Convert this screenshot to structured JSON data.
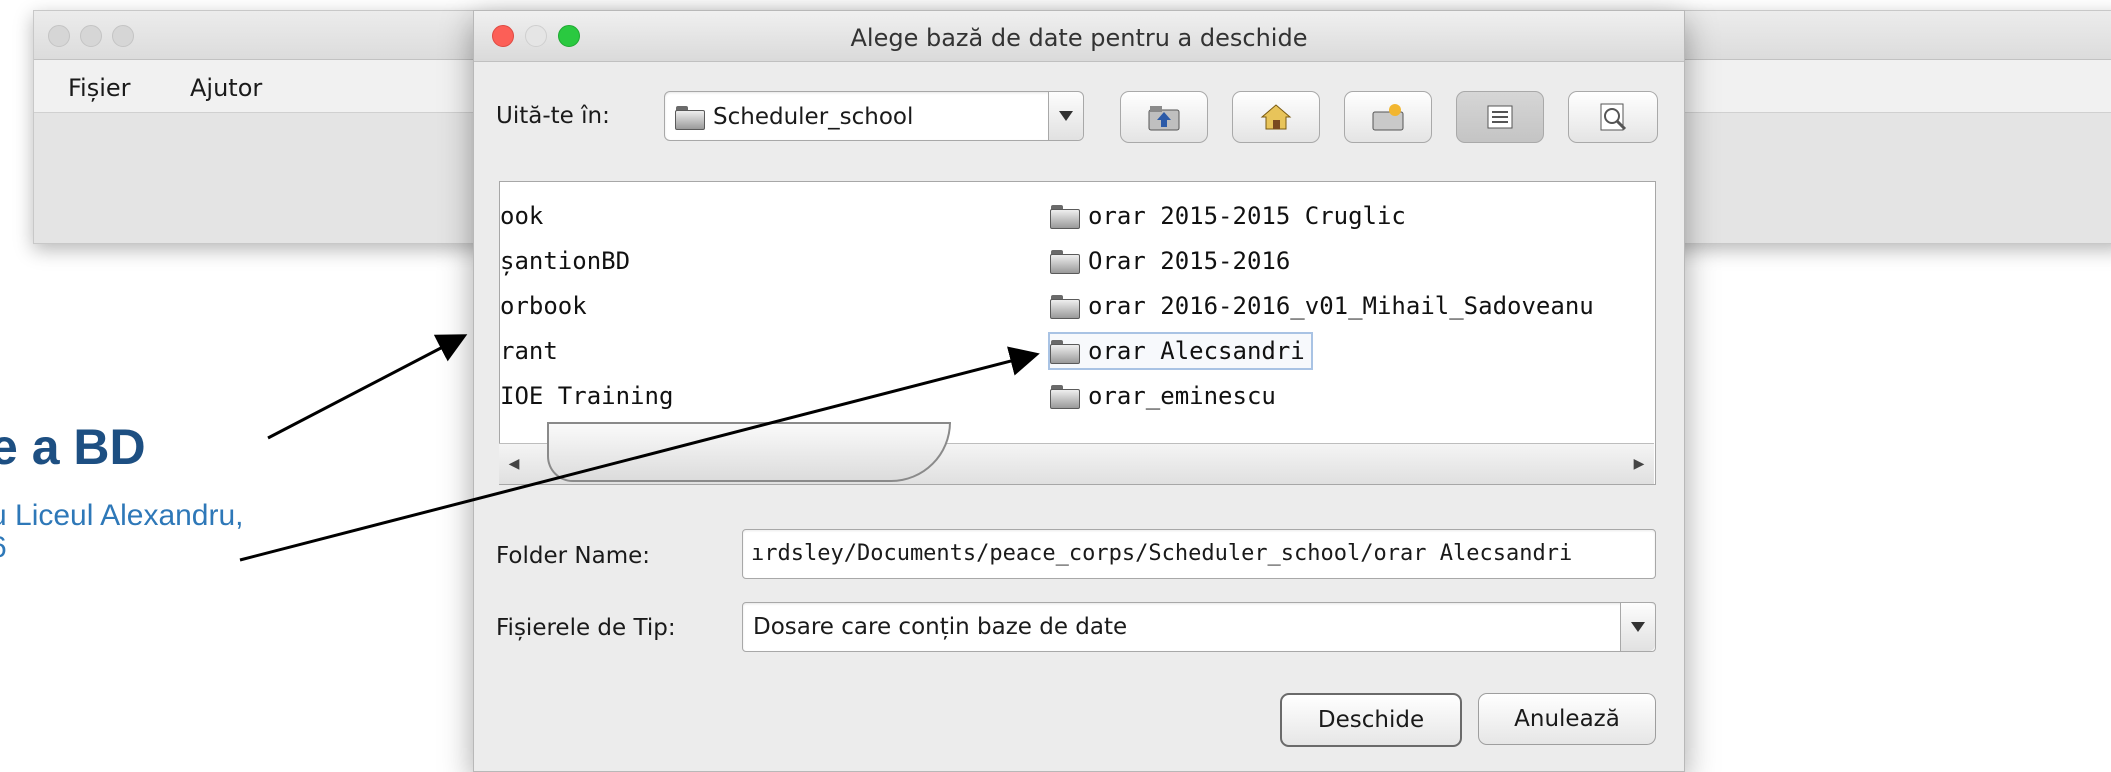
{
  "background_window": {
    "menu": [
      "Fișier",
      "Ajutor"
    ]
  },
  "annotation": {
    "title": "e a BD",
    "subtitle_line1": "u Liceul Alexandru,",
    "subtitle_line2": "6"
  },
  "dialog": {
    "title": "Alege bază de date pentru a deschide",
    "look_in_label": "Uită-te în:",
    "look_in_value": "Scheduler_school",
    "toolbar_icons": [
      "up-folder-icon",
      "home-icon",
      "new-folder-icon",
      "list-view-icon",
      "details-view-icon"
    ],
    "files_left": [
      "ook",
      "șantionBD",
      "orbook",
      "rant",
      "IOE Training"
    ],
    "files_right": [
      "orar 2015-2015 Cruglic",
      "Orar 2015-2016",
      "orar 2016-2016_v01_Mihail_Sadoveanu",
      "orar Alecsandri",
      "orar_eminescu"
    ],
    "selected_file": "orar Alecsandri",
    "folder_name_label": "Folder Name:",
    "folder_name_value": "ırdsley/Documents/peace_corps/Scheduler_school/orar Alecsandri",
    "file_type_label": "Fișierele de Tip:",
    "file_type_value": "Dosare care conțin baze de date",
    "open_button": "Deschide",
    "cancel_button": "Anulează"
  }
}
